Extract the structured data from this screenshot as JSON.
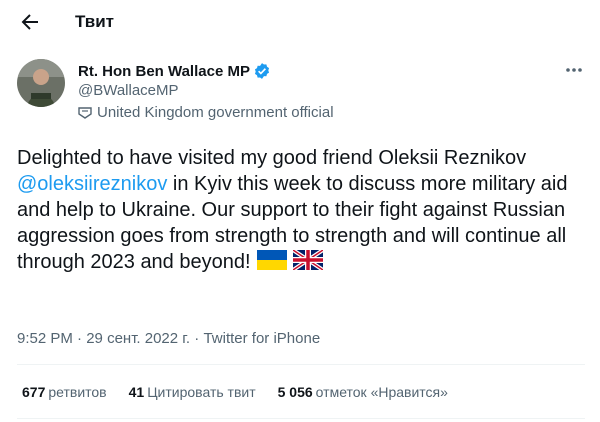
{
  "header": {
    "title": "Твит"
  },
  "author": {
    "name": "Rt. Hon Ben Wallace MP",
    "handle": "@BWallaceMP",
    "label": "United Kingdom government official"
  },
  "tweet": {
    "text_part1": "Delighted to have visited my good friend Oleksii Reznikov ",
    "mention": "@oleksiireznikov",
    "text_part2": " in Kyiv this week to discuss more military aid and help to Ukraine. Our support to their fight against Russian aggression goes from strength to strength and will continue all through 2023 and beyond!",
    "flags": [
      "ukraine-flag",
      "uk-flag"
    ]
  },
  "meta": {
    "time": "9:52 PM",
    "sep1": " · ",
    "date": "29 сент. 2022 г.",
    "sep2": " · ",
    "source": "Twitter for iPhone"
  },
  "stats": {
    "retweets_count": "677",
    "retweets_label": "ретвитов",
    "quotes_count": "41",
    "quotes_label": "Цитировать твит",
    "likes_count": "5 056",
    "likes_label": "отметок «Нравится»"
  },
  "colors": {
    "link": "#1d9bf0",
    "secondary": "#536471",
    "text": "#0f1419",
    "divider": "#eff3f4"
  }
}
